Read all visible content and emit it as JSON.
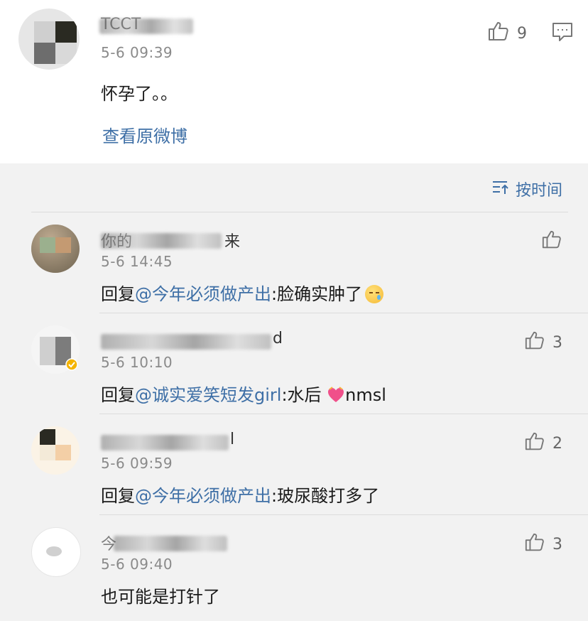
{
  "post": {
    "username_visible": "TCCT",
    "timestamp": "5-6 09:39",
    "text": "怀孕了。。",
    "like_count": "9",
    "view_original_link": "查看原微博"
  },
  "sort_label": "按时间",
  "icons": {
    "like": "thumbs-up-icon",
    "comment": "comment-icon",
    "sort": "sort-icon"
  },
  "colors": {
    "link": "#3e6fa6",
    "background": "#f2f2f2",
    "card": "#ffffff"
  },
  "comments": [
    {
      "username_visible": "你的",
      "username_tail": "来",
      "timestamp": "5-6 14:45",
      "reply_prefix": "回复",
      "mention": "@今年必须做产出",
      "body": ":脸确实肿了",
      "like_count": ""
    },
    {
      "username_visible": "",
      "username_tail": "d",
      "timestamp": "5-6 10:10",
      "reply_prefix": "回复",
      "mention": "@诚实爱笑短发girl",
      "body": ":水后",
      "body_tail": "nmsl",
      "like_count": "3"
    },
    {
      "username_visible": "",
      "username_tail": "l",
      "timestamp": "5-6 09:59",
      "reply_prefix": "回复",
      "mention": "@今年必须做产出",
      "body": ":玻尿酸打多了",
      "like_count": "2"
    },
    {
      "username_visible": "今",
      "username_tail": "",
      "timestamp": "5-6 09:40",
      "reply_prefix": "",
      "mention": "",
      "body": "也可能是打针了",
      "like_count": "3"
    }
  ]
}
